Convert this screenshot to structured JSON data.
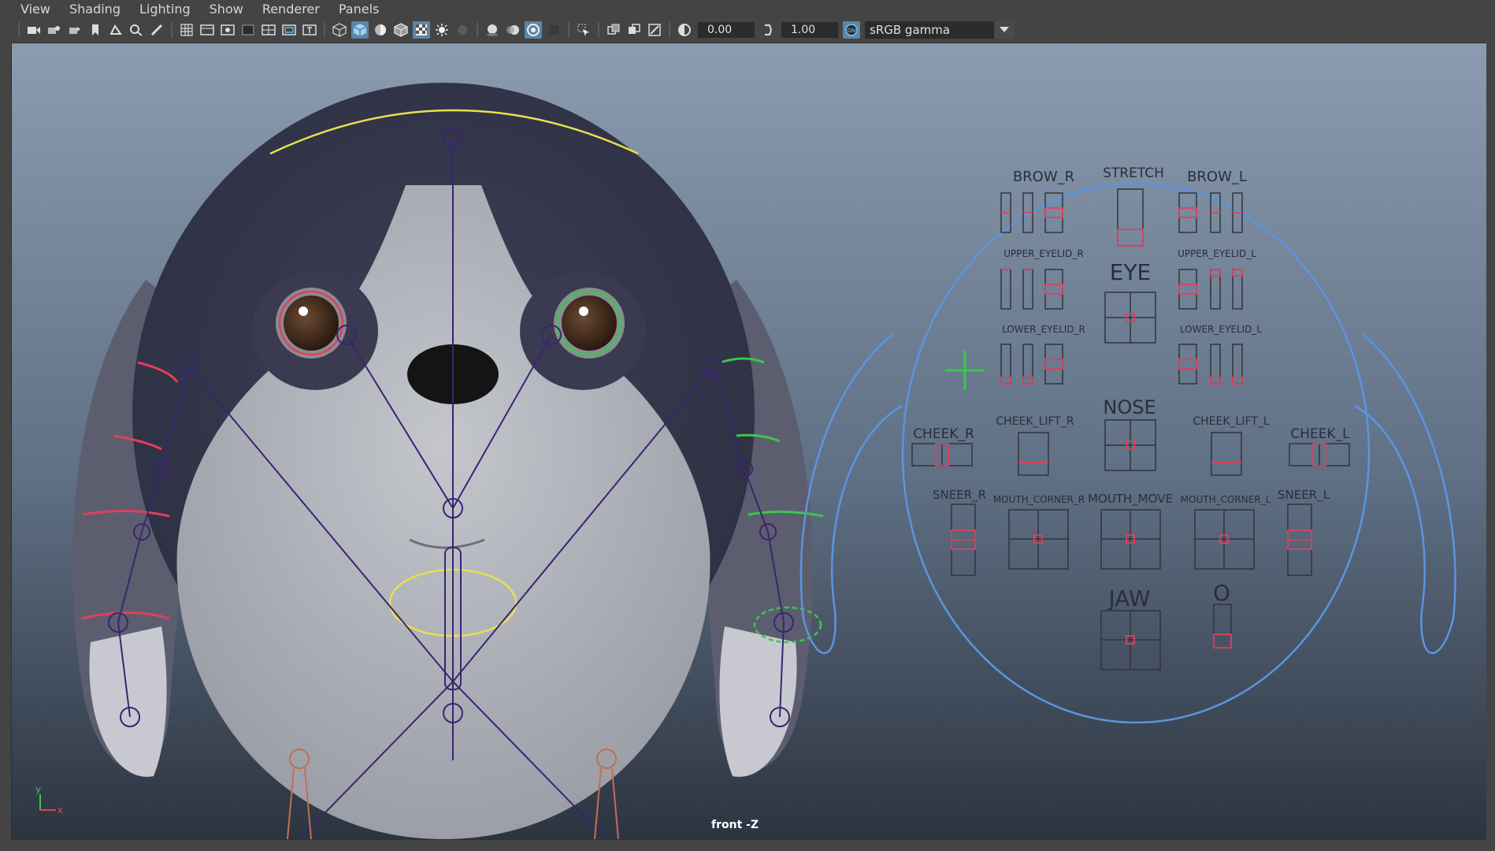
{
  "menu": [
    "View",
    "Shading",
    "Lighting",
    "Show",
    "Renderer",
    "Panels"
  ],
  "toolbar": {
    "exposure": "0.00",
    "gamma": "1.00",
    "color_space": "sRGB gamma"
  },
  "viewport": {
    "camera_label": "front -Z",
    "axis_y": "y",
    "axis_x": "x"
  },
  "face_ui": {
    "labels": {
      "brow_r": "BROW_R",
      "stretch": "STRETCH",
      "brow_l": "BROW_L",
      "upper_eyelid_r": "UPPER_EYELID_R",
      "upper_eyelid_l": "UPPER_EYELID_L",
      "eye": "EYE",
      "lower_eyelid_r": "LOWER_EYELID_R",
      "lower_eyelid_l": "LOWER_EYELID_L",
      "nose": "NOSE",
      "cheek_r": "CHEEK_R",
      "cheek_lift_r": "CHEEK_LIFT_R",
      "cheek_lift_l": "CHEEK_LIFT_L",
      "cheek_l": "CHEEK_L",
      "sneer_r": "SNEER_R",
      "mouth_corner_r": "MOUTH_CORNER_R",
      "mouth_move": "MOUTH_MOVE",
      "mouth_corner_l": "MOUTH_CORNER_L",
      "sneer_l": "SNEER_L",
      "jaw": "JAW",
      "o": "O"
    }
  },
  "colors": {
    "accent": "#5d85a6",
    "panel_outline": "#5b95e0",
    "control_red": "#e0405a",
    "control_green": "#39c84a",
    "control_yellow": "#e8e050",
    "joint_purple": "#3b2470"
  }
}
